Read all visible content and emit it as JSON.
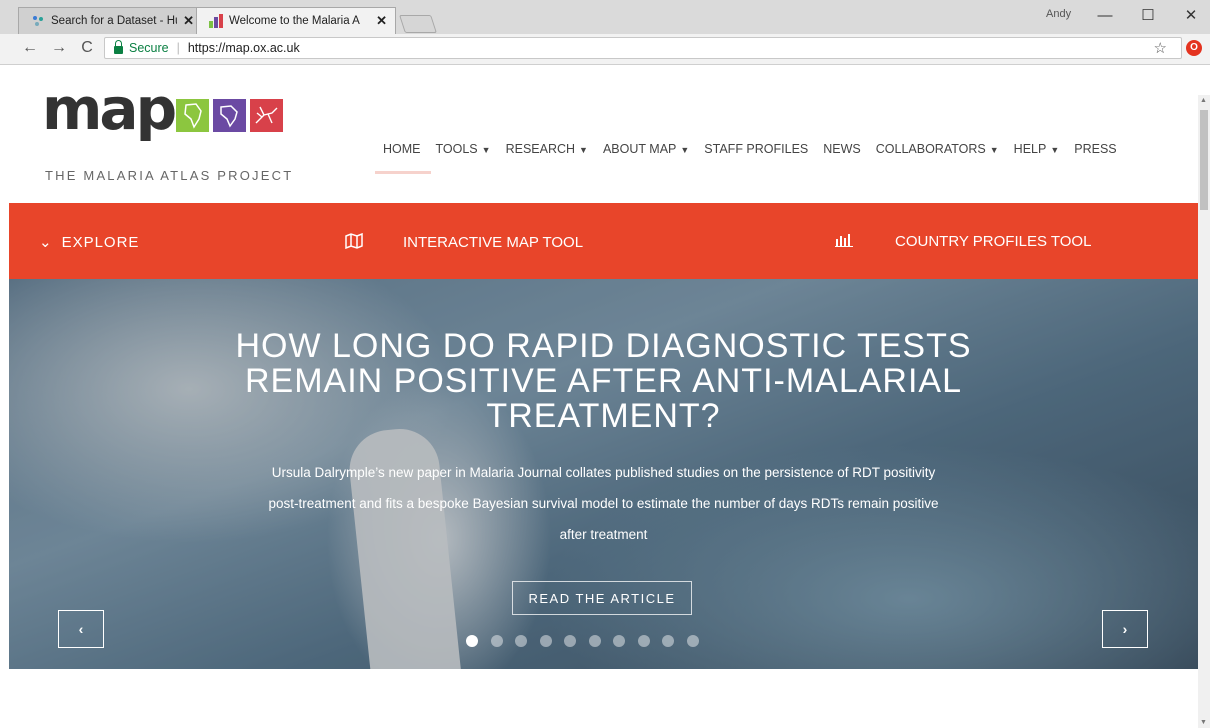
{
  "browser": {
    "tabs": [
      {
        "title": "Search for a Dataset - Hu",
        "close": "✕",
        "active": false
      },
      {
        "title": "Welcome to the Malaria A",
        "close": "✕",
        "active": true
      }
    ],
    "profile_name": "Andy",
    "window_controls": {
      "minimize": "—",
      "maximize": "☐",
      "close": "✕"
    },
    "nav": {
      "back": "←",
      "forward": "→",
      "reload": "C"
    },
    "address": {
      "secure_label": "Secure",
      "separator": "|",
      "url": "https://map.ox.ac.uk"
    },
    "bookmark_icon": "star-icon",
    "extension_icon": "opera-extension-icon",
    "colors": {
      "secure": "#0b8043",
      "extension": "#e4331f"
    }
  },
  "site": {
    "logo": {
      "word": "map",
      "tagline": "THE MALARIA ATLAS PROJECT"
    },
    "nav": [
      {
        "label": "HOME",
        "dropdown": false
      },
      {
        "label": "TOOLS",
        "dropdown": true
      },
      {
        "label": "RESEARCH",
        "dropdown": true
      },
      {
        "label": "ABOUT MAP",
        "dropdown": true
      },
      {
        "label": "STAFF PROFILES",
        "dropdown": false
      },
      {
        "label": "NEWS",
        "dropdown": false
      },
      {
        "label": "COLLABORATORS",
        "dropdown": true
      },
      {
        "label": "HELP",
        "dropdown": true
      },
      {
        "label": "PRESS",
        "dropdown": false
      }
    ],
    "dropdown_glyph": "▼",
    "red_bar": {
      "explore": {
        "chevron": "⌄",
        "label": "EXPLORE"
      },
      "interactive": {
        "icon": "map-icon",
        "label": "INTERACTIVE MAP TOOL"
      },
      "country": {
        "icon": "bar-chart-icon",
        "label": "COUNTRY PROFILES TOOL"
      },
      "color": "#e8452a"
    },
    "hero": {
      "title_lines": [
        "HOW LONG DO RAPID DIAGNOSTIC TESTS",
        "REMAIN POSITIVE AFTER ANTI-MALARIAL",
        "TREATMENT?"
      ],
      "description_lines": [
        "Ursula Dalrymple’s new paper in Malaria Journal collates published studies on the persistence of RDT positivity",
        "post-treatment and fits a bespoke Bayesian survival model to estimate the number of days RDTs remain positive",
        "after treatment"
      ],
      "cta": "READ THE ARTICLE",
      "prev": "‹",
      "next": "›",
      "slide_count": 10,
      "active_slide": 1
    }
  }
}
